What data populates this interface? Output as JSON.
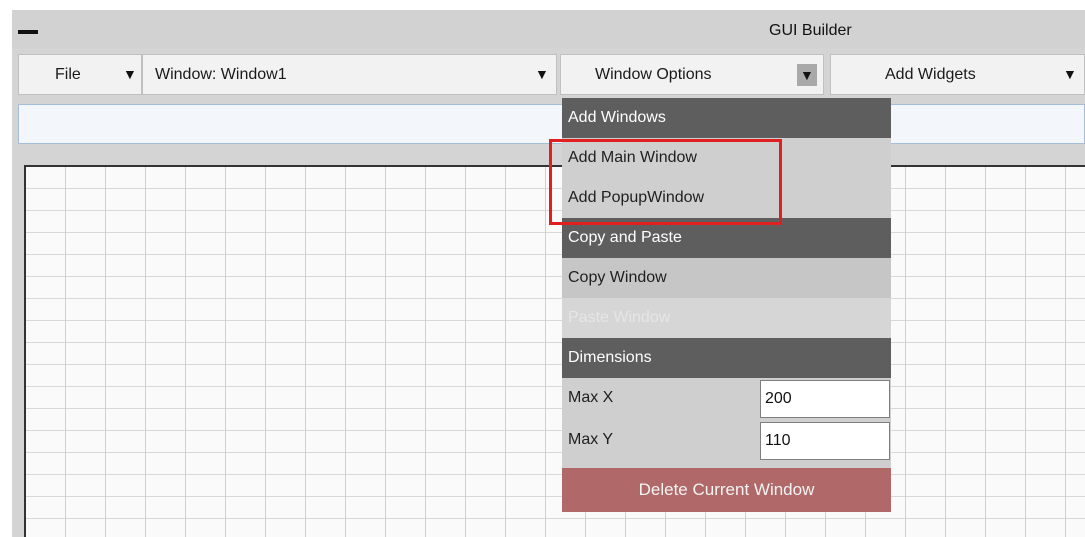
{
  "titlebar": {
    "title": "GUI Builder"
  },
  "toolbar": {
    "file_label": "File",
    "window_select": "Window: Window1",
    "window_options_label": "Window Options",
    "add_widgets_label": "Add Widgets",
    "arrow": "▼"
  },
  "menu": {
    "add_windows_header": "Add Windows",
    "add_main_window": "Add Main Window",
    "add_popup_window": "Add PopupWindow",
    "copy_paste_header": "Copy and Paste",
    "copy_window": "Copy Window",
    "paste_window": "Paste Window",
    "dimensions_header": "Dimensions",
    "max_x_label": "Max X",
    "max_x_value": "200",
    "max_y_label": "Max Y",
    "max_y_value": "110",
    "delete_button": "Delete Current Window"
  },
  "colors": {
    "menu_header": "#5e5e5e",
    "delete_button": "#b06868",
    "highlight_box": "#e02020"
  }
}
